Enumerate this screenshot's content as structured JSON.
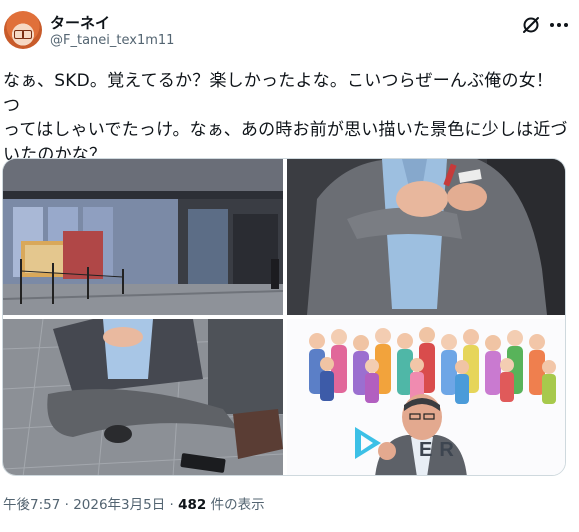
{
  "user": {
    "display_name": "ターネイ",
    "handle": "@F_tanei_tex1m11",
    "avatar_icon": "avatar-illustration"
  },
  "header": {
    "grok_icon": "grok-icon",
    "more_icon": "more-options-icon"
  },
  "tweet": {
    "text": "なぁ、SKD。覚えてるか？楽しかったよな。こいつらぜーんぶ俺の女！つ\nってはしゃいでたっけ。なぁ、あの時お前が思い描いた景色に少しは近づ\nいたのかな？"
  },
  "media": {
    "photo4_text": "ER"
  },
  "meta": {
    "time": "午後7:57",
    "sep1": " · ",
    "date": "2026年3月5日",
    "sep2": " · ",
    "views_count": "482",
    "views_label": " 件の表示"
  },
  "colors": {
    "text": "#0f1419",
    "secondary": "#536471",
    "border": "#cfd9de",
    "avatar": "#e0703a"
  }
}
